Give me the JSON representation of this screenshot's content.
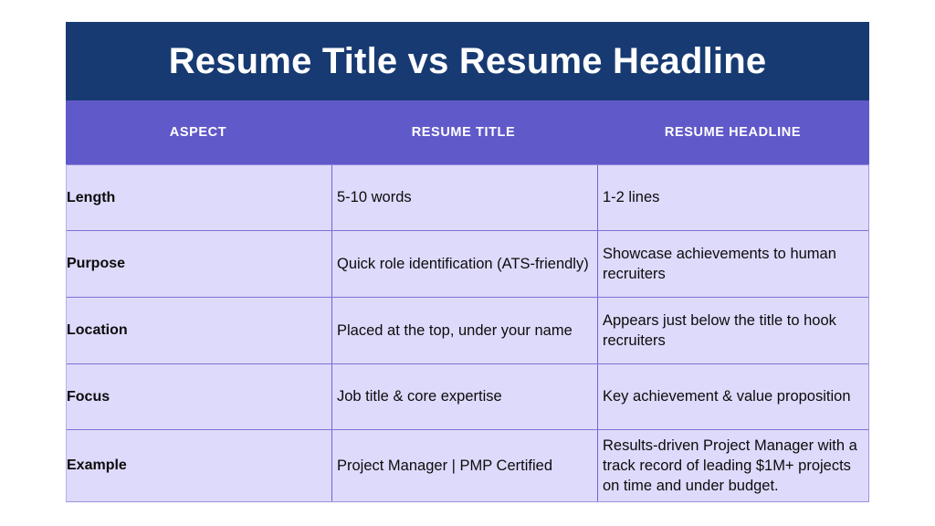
{
  "slide": {
    "title": "Resume Title vs Resume Headline",
    "background_color": "#ffffff"
  },
  "colors": {
    "title_band": "#173a72",
    "header_band": "#6059c9",
    "cell_background": "#dedafb",
    "grid_line": "#7b74d4",
    "title_text": "#ffffff",
    "header_text": "#ffffff",
    "body_text": "#0c0c0c"
  },
  "table": {
    "columns": [
      {
        "key": "aspect",
        "label": "ASPECT"
      },
      {
        "key": "resume_title",
        "label": "RESUME TITLE"
      },
      {
        "key": "resume_headline",
        "label": "RESUME HEADLINE"
      }
    ],
    "rows": [
      {
        "aspect": "Length",
        "resume_title": "5-10 words",
        "resume_headline": "1-2 lines"
      },
      {
        "aspect": "Purpose",
        "resume_title": "Quick role identification (ATS-friendly)",
        "resume_headline": "Showcase achievements to human recruiters"
      },
      {
        "aspect": "Location",
        "resume_title": "Placed at the top, under your name",
        "resume_headline": "Appears just below the title to hook recruiters"
      },
      {
        "aspect": "Focus",
        "resume_title": "Job title & core expertise",
        "resume_headline": "Key achievement & value proposition"
      },
      {
        "aspect": "Example",
        "resume_title": "Project Manager | PMP Certified",
        "resume_headline": "Results-driven Project Manager with a track record of leading $1M+ projects on time and under budget."
      }
    ]
  }
}
